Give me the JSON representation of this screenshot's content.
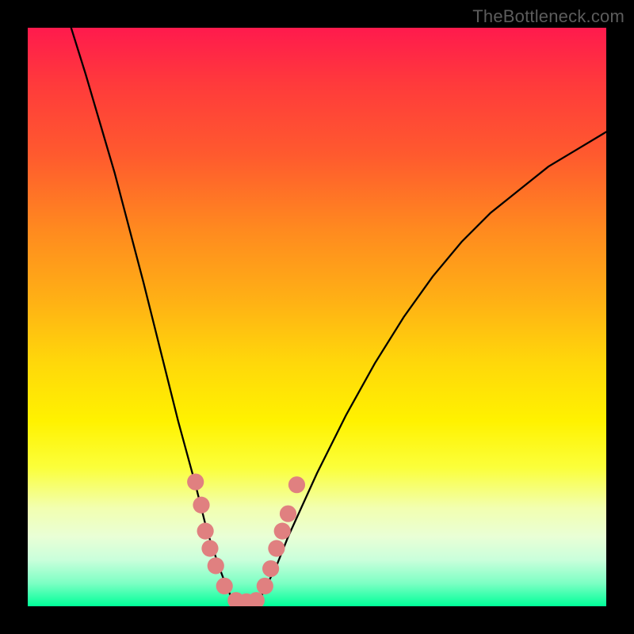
{
  "watermark": "TheBottleneck.com",
  "chart_data": {
    "type": "line",
    "title": "",
    "xlabel": "",
    "ylabel": "",
    "xlim": [
      0,
      1
    ],
    "ylim": [
      0,
      1
    ],
    "x": [
      0.0,
      0.05,
      0.1,
      0.15,
      0.2,
      0.23,
      0.26,
      0.29,
      0.31,
      0.33,
      0.35,
      0.37,
      0.39,
      0.41,
      0.43,
      0.45,
      0.5,
      0.55,
      0.6,
      0.65,
      0.7,
      0.75,
      0.8,
      0.85,
      0.9,
      0.95,
      1.0
    ],
    "series": [
      {
        "name": "left-curve",
        "x": [
          0.075,
          0.1,
          0.15,
          0.2,
          0.23,
          0.26,
          0.29,
          0.31,
          0.33,
          0.345,
          0.36
        ],
        "values": [
          1.0,
          0.92,
          0.75,
          0.56,
          0.44,
          0.32,
          0.21,
          0.13,
          0.07,
          0.03,
          0.0
        ]
      },
      {
        "name": "right-curve",
        "x": [
          0.395,
          0.41,
          0.43,
          0.45,
          0.5,
          0.55,
          0.6,
          0.65,
          0.7,
          0.75,
          0.8,
          0.85,
          0.9,
          0.95,
          1.0
        ],
        "values": [
          0.0,
          0.03,
          0.07,
          0.12,
          0.23,
          0.33,
          0.42,
          0.5,
          0.57,
          0.63,
          0.68,
          0.72,
          0.76,
          0.79,
          0.82
        ]
      }
    ],
    "markers": {
      "name": "marker-dots",
      "color": "#e08080",
      "radius_frac": 0.0145,
      "points": [
        {
          "x": 0.29,
          "y": 0.215
        },
        {
          "x": 0.3,
          "y": 0.175
        },
        {
          "x": 0.307,
          "y": 0.13
        },
        {
          "x": 0.315,
          "y": 0.1
        },
        {
          "x": 0.325,
          "y": 0.07
        },
        {
          "x": 0.34,
          "y": 0.035
        },
        {
          "x": 0.36,
          "y": 0.01
        },
        {
          "x": 0.378,
          "y": 0.008
        },
        {
          "x": 0.395,
          "y": 0.01
        },
        {
          "x": 0.41,
          "y": 0.035
        },
        {
          "x": 0.42,
          "y": 0.065
        },
        {
          "x": 0.43,
          "y": 0.1
        },
        {
          "x": 0.44,
          "y": 0.13
        },
        {
          "x": 0.45,
          "y": 0.16
        },
        {
          "x": 0.465,
          "y": 0.21
        }
      ]
    }
  }
}
